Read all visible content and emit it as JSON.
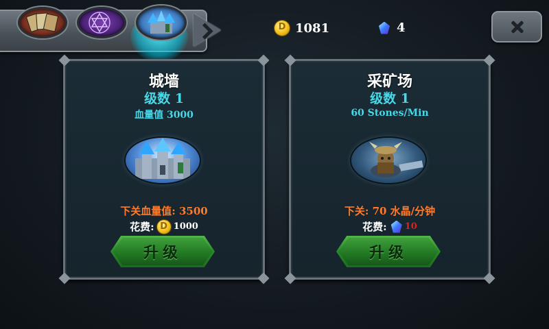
{
  "tabs": [
    {
      "name": "cards",
      "active": false
    },
    {
      "name": "magic-circle",
      "active": false
    },
    {
      "name": "castle-upgrade",
      "active": true
    }
  ],
  "resources": {
    "gold": "1081",
    "crystals": "4"
  },
  "colors": {
    "accent_cyan": "#48d8e8",
    "next_level_orange": "#ff7b2a",
    "cost_red": "#e02020",
    "button_green": "#2a8a2a"
  },
  "cards": [
    {
      "title": "城墙",
      "level": "级数 1",
      "stat": "血量值 3000",
      "next": "下关血量值: 3500",
      "cost_label": "花费:",
      "cost_icon": "gold-coin-icon",
      "cost_value": "1000",
      "button": "升级"
    },
    {
      "title": "采矿场",
      "level": "级数 1",
      "stat": "60 Stones/Min",
      "next": "下关: 70 水晶/分钟",
      "cost_label": "花费:",
      "cost_icon": "crystal-icon",
      "cost_value": "10",
      "button": "升级"
    }
  ]
}
